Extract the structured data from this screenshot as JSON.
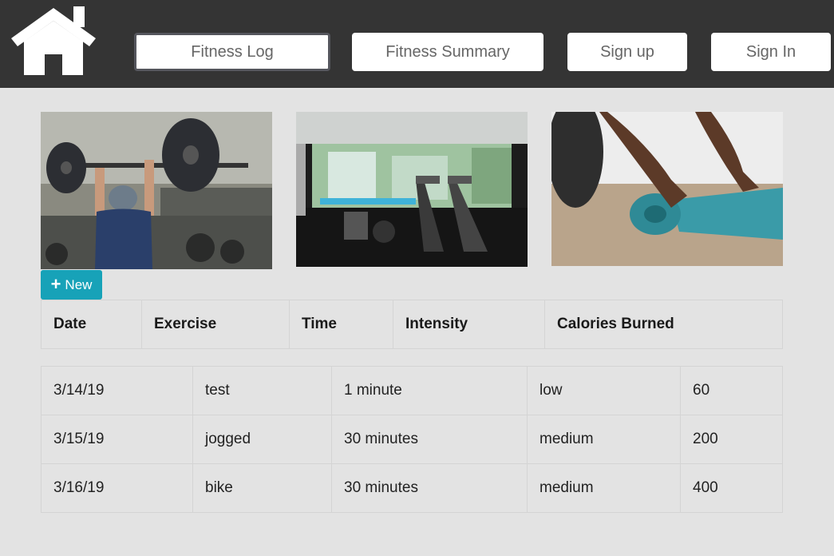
{
  "nav": {
    "items": [
      {
        "label": "Fitness Log",
        "active": true
      },
      {
        "label": "Fitness Summary",
        "active": false
      },
      {
        "label": "Sign up",
        "active": false
      },
      {
        "label": "Sign In",
        "active": false
      }
    ],
    "home_icon": "home-icon"
  },
  "actions": {
    "new_label": "New",
    "new_icon": "plus-icon",
    "new_color": "#17a2b8"
  },
  "table": {
    "headers": [
      "Date",
      "Exercise",
      "Time",
      "Intensity",
      "Calories Burned"
    ],
    "rows": [
      [
        "3/14/19",
        "test",
        "1 minute",
        "low",
        "60"
      ],
      [
        "3/15/19",
        "jogged",
        "30 minutes",
        "medium",
        "200"
      ],
      [
        "3/16/19",
        "bike",
        "30 minutes",
        "medium",
        "400"
      ]
    ]
  },
  "colors": {
    "topbar": "#343434",
    "background": "#e3e3e3"
  }
}
